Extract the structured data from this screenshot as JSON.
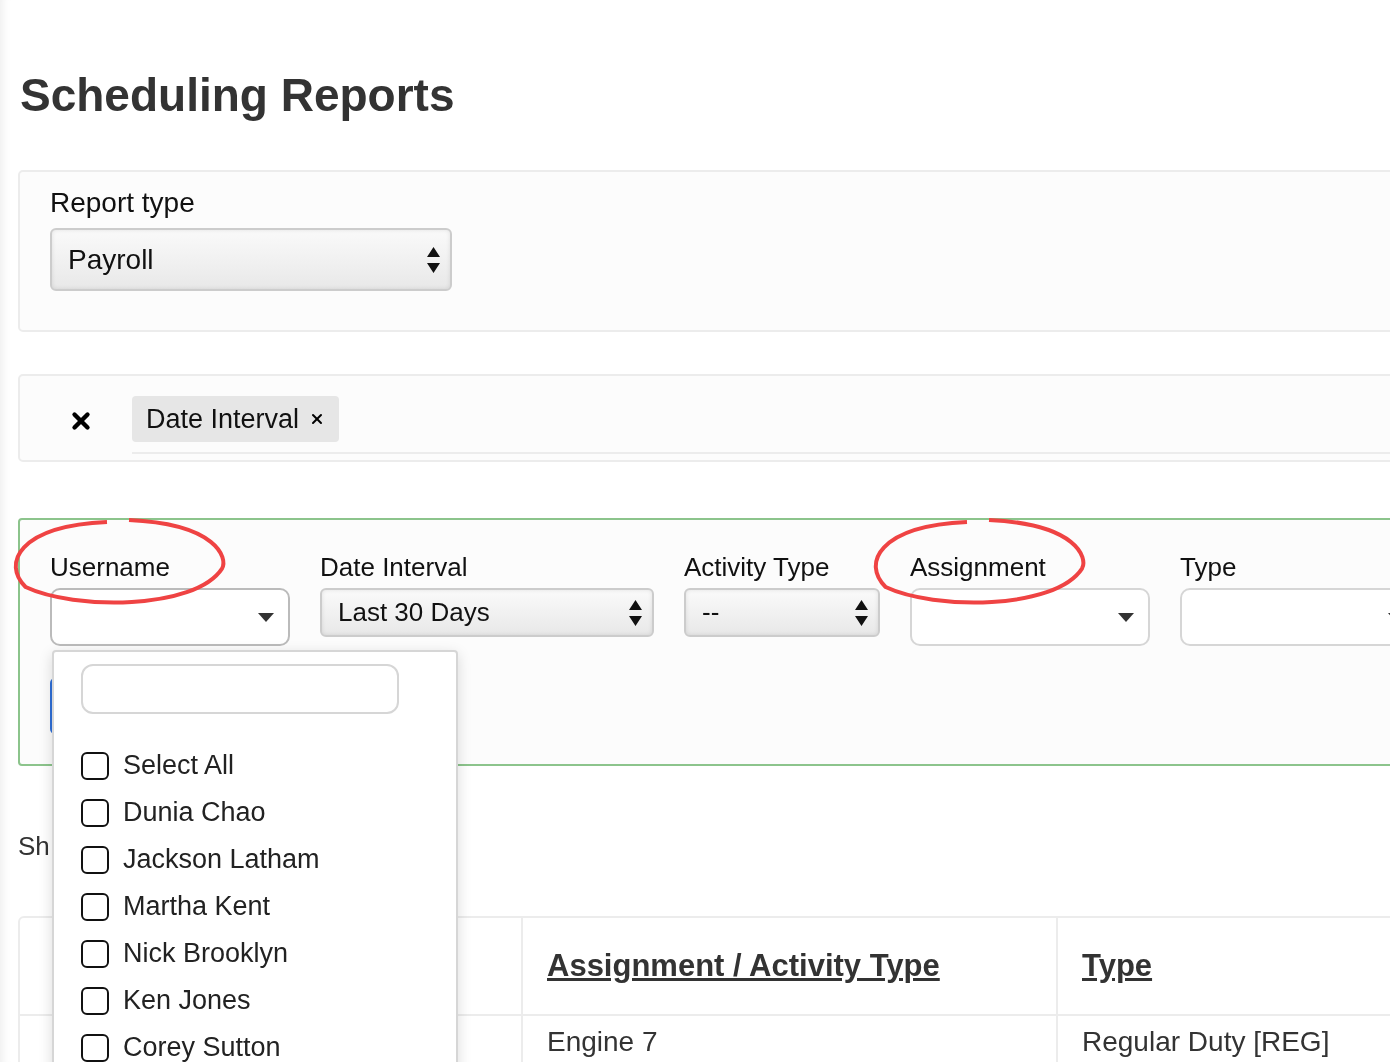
{
  "page": {
    "title": "Scheduling Reports"
  },
  "report_type": {
    "label": "Report type",
    "value": "Payroll"
  },
  "active_filters": {
    "chips": [
      {
        "label": "Date Interval"
      }
    ]
  },
  "filters": [
    {
      "label": "Username",
      "kind": "multiselect",
      "annotated": true,
      "open": true
    },
    {
      "label": "Date Interval",
      "kind": "select",
      "value": "Last 30 Days",
      "annotated": false
    },
    {
      "label": "Activity Type",
      "kind": "select",
      "value": "--",
      "annotated": false
    },
    {
      "label": "Assignment",
      "kind": "multiselect",
      "annotated": true,
      "open": false
    },
    {
      "label": "Type",
      "kind": "multiselect",
      "annotated": false,
      "open": false
    }
  ],
  "username_dropdown": {
    "options": [
      {
        "label": "Select All",
        "checked": false
      },
      {
        "label": "Dunia Chao",
        "checked": false
      },
      {
        "label": "Jackson Latham",
        "checked": false
      },
      {
        "label": "Martha Kent",
        "checked": false
      },
      {
        "label": "Nick Brooklyn",
        "checked": false
      },
      {
        "label": "Ken Jones",
        "checked": false
      },
      {
        "label": "Corey Sutton",
        "checked": false
      }
    ]
  },
  "summary_text": "Sh",
  "table": {
    "columns": [
      "Assignment / Activity Type",
      "Type"
    ],
    "rows": [
      [
        "Engine 7",
        "Regular Duty [REG]"
      ]
    ]
  }
}
